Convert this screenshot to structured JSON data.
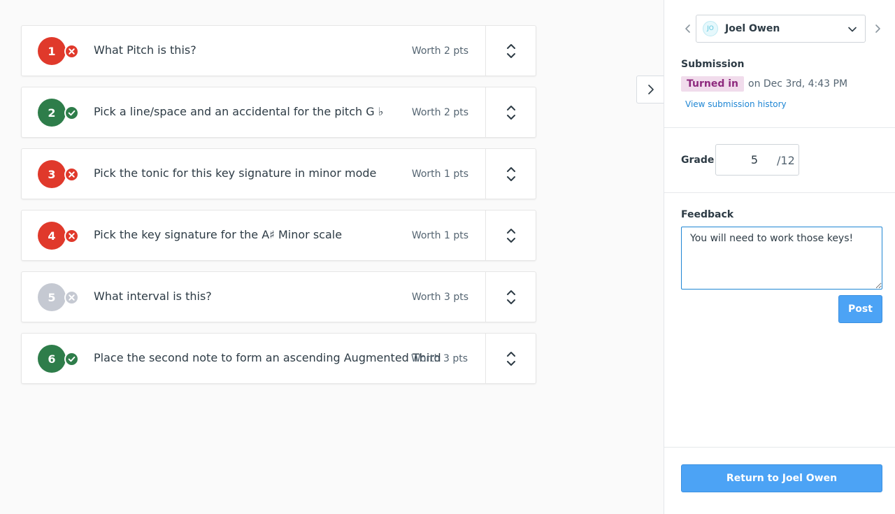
{
  "questions": [
    {
      "number": "1",
      "text": "What Pitch is this?",
      "worth": "Worth 2 pts",
      "status": "incorrect",
      "color": "#e0392b"
    },
    {
      "number": "2",
      "text": "Pick a line/space and an accidental for the pitch G ♭",
      "worth": "Worth 2 pts",
      "status": "correct",
      "color": "#2e7d4a"
    },
    {
      "number": "3",
      "text": "Pick the tonic for this key signature in minor mode",
      "worth": "Worth 1 pts",
      "status": "incorrect",
      "color": "#e0392b"
    },
    {
      "number": "4",
      "text": "Pick the key signature for the A♯ Minor scale",
      "worth": "Worth 1 pts",
      "status": "incorrect",
      "color": "#e0392b"
    },
    {
      "number": "5",
      "text": "What interval is this?",
      "worth": "Worth 3 pts",
      "status": "ungraded",
      "color": "#c5c9d2"
    },
    {
      "number": "6",
      "text": "Place the second note to form an ascending Augmented Third",
      "worth": "Worth 3 pts",
      "status": "correct",
      "color": "#2e7d4a"
    }
  ],
  "student": {
    "initials": "JO",
    "name": "Joel Owen"
  },
  "submission": {
    "title": "Submission",
    "status_badge": "Turned in",
    "date": "on Dec 3rd, 4:43 PM",
    "history_link": "View submission history"
  },
  "grade": {
    "label": "Grade",
    "value": "5",
    "max": "/12"
  },
  "feedback": {
    "label": "Feedback",
    "text": "You will need to work those keys!"
  },
  "buttons": {
    "post": "Post",
    "return": "Return to Joel Owen"
  }
}
